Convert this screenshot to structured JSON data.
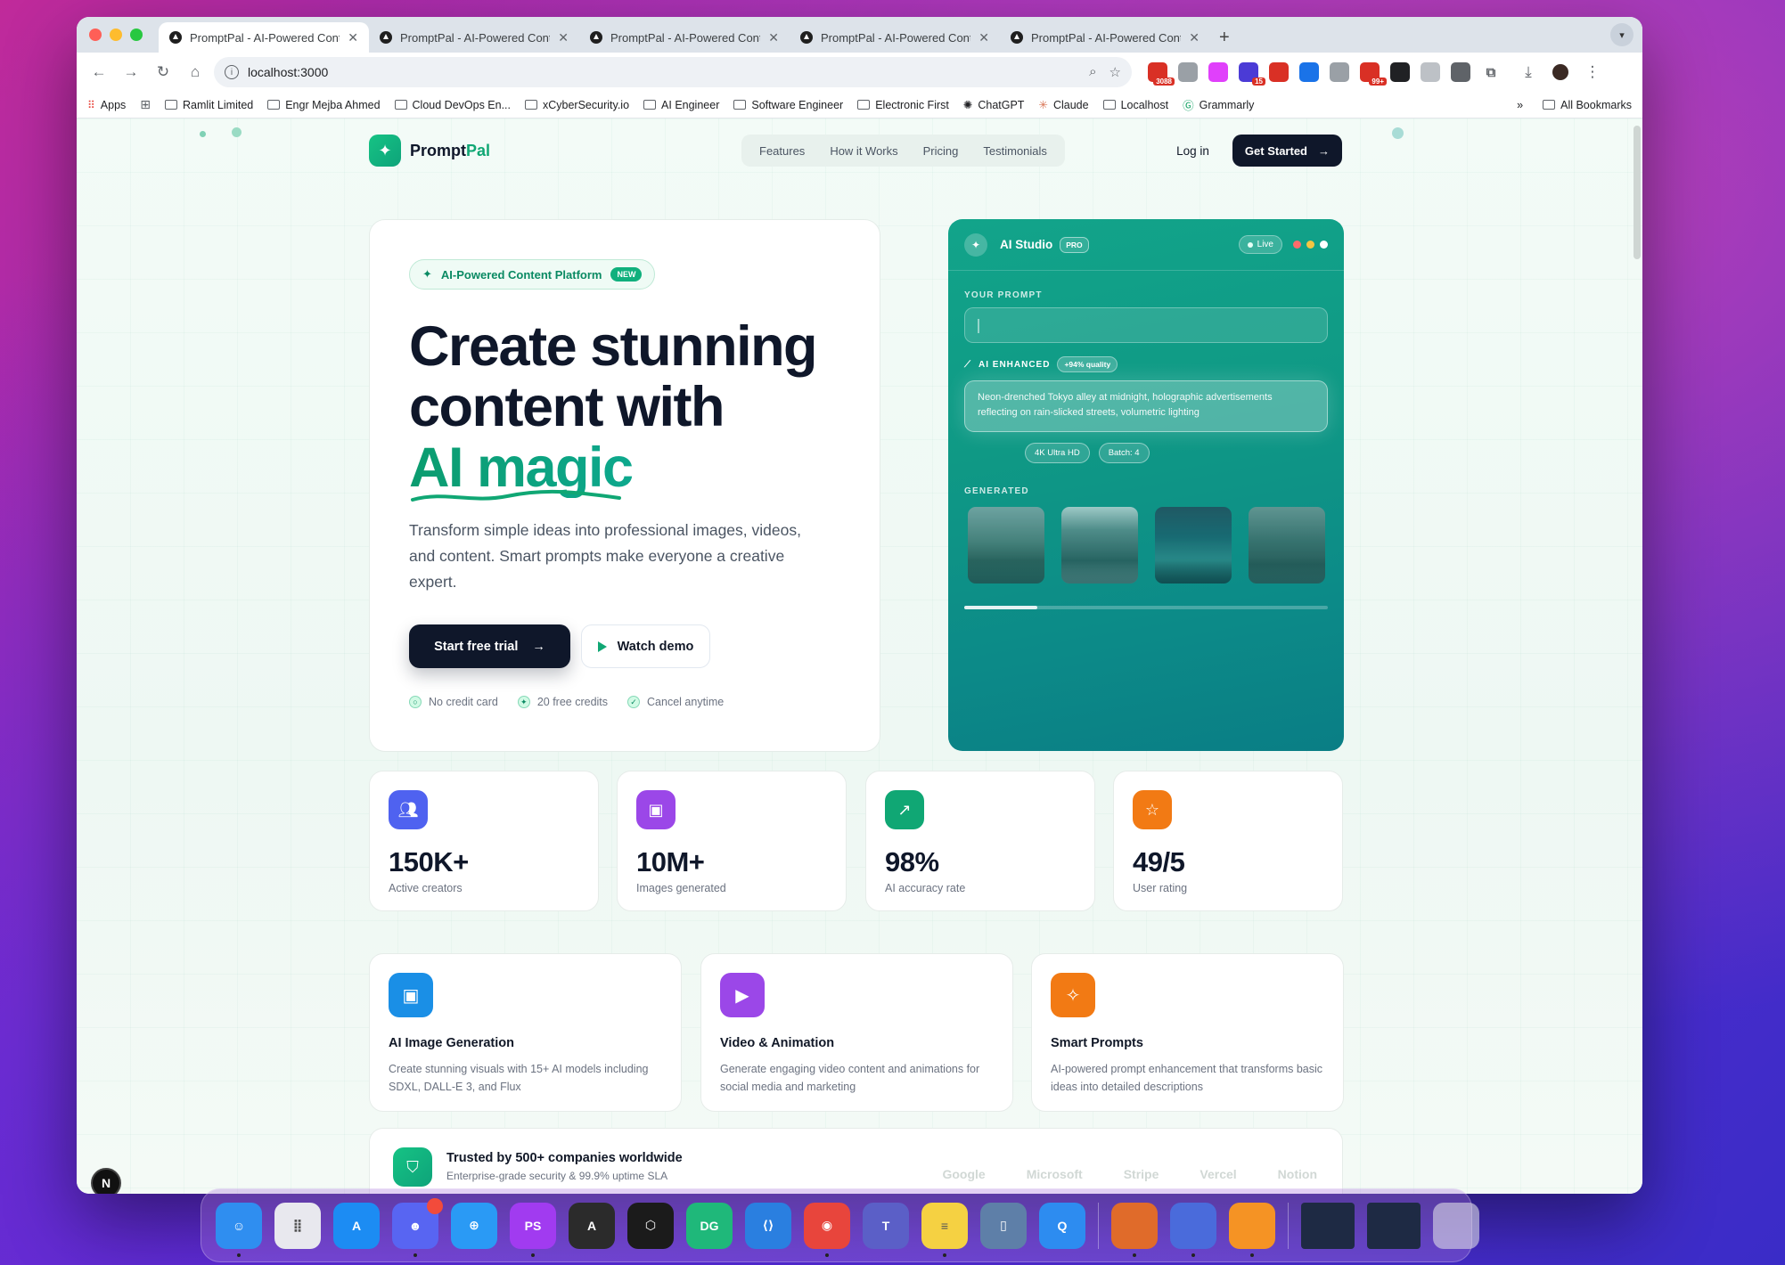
{
  "browser": {
    "tabs": [
      {
        "title": "PromptPal - AI-Powered Cont",
        "active": true
      },
      {
        "title": "PromptPal - AI-Powered Cont",
        "active": false
      },
      {
        "title": "PromptPal - AI-Powered Cont",
        "active": false
      },
      {
        "title": "PromptPal - AI-Powered Cont",
        "active": false
      },
      {
        "title": "PromptPal - AI-Powered Cont",
        "active": false
      }
    ],
    "url": "localhost:3000",
    "extensions": [
      {
        "name": "gmail-ext",
        "badge": "3088",
        "color": "#d93025"
      },
      {
        "name": "camera-ext",
        "badge": "",
        "color": "#9aa0a6"
      },
      {
        "name": "arrow-ext",
        "badge": "",
        "color": "#e040fb"
      },
      {
        "name": "hat-ext",
        "badge": "15",
        "color": "#4b3bd6"
      },
      {
        "name": "opera-ext",
        "badge": "",
        "color": "#d93025"
      },
      {
        "name": "tag-ext",
        "badge": "",
        "color": "#1a73e8"
      },
      {
        "name": "code-ext",
        "badge": "",
        "color": "#9aa0a6"
      },
      {
        "name": "mail-ext",
        "badge": "99+",
        "color": "#d93025"
      },
      {
        "name": "grid-ext",
        "badge": "",
        "color": "#202124"
      },
      {
        "name": "link-ext",
        "badge": "",
        "color": "#bdc1c6"
      },
      {
        "name": "pen-ext",
        "badge": "",
        "color": "#5f6368"
      }
    ],
    "bookmarks": [
      "Apps",
      "Ramlit Limited",
      "Engr Mejba Ahmed",
      "Cloud DevOps En...",
      "xCyberSecurity.io",
      "AI Engineer",
      "Software Engineer",
      "Electronic First",
      "ChatGPT",
      "Claude",
      "Localhost",
      "Grammarly"
    ],
    "all_bookmarks": "All Bookmarks",
    "more": "»"
  },
  "nav": {
    "brand": "Prompt",
    "brand_accent": "Pal",
    "links": [
      "Features",
      "How it Works",
      "Pricing",
      "Testimonials"
    ],
    "login": "Log in",
    "cta": "Get Started"
  },
  "hero": {
    "badge": "AI-Powered Content Platform",
    "badge_new": "NEW",
    "title_line1": "Create stunning",
    "title_line2": "content with",
    "title_highlight": "AI magic",
    "subtitle": "Transform simple ideas into professional images, videos, and content. Smart prompts make everyone a creative expert.",
    "primary_cta": "Start free trial",
    "secondary_cta": "Watch demo",
    "trust": [
      "No credit card",
      "20 free credits",
      "Cancel anytime"
    ]
  },
  "studio": {
    "title": "AI Studio",
    "badge": "PRO",
    "status": "Live",
    "prompt_label": "YOUR PROMPT",
    "enhanced_label": "AI ENHANCED",
    "quality": "+94% quality",
    "enhanced_text": "Neon-drenched Tokyo alley at midnight, holographic advertisements reflecting on rain-slicked streets, volumetric lighting",
    "chips": [
      "4K Ultra HD",
      "Batch: 4"
    ],
    "generated_label": "GENERATED",
    "progress": 0.2
  },
  "stats": [
    {
      "value": "150K+",
      "label": "Active creators",
      "icon": "users-icon",
      "color": "#4f62f0"
    },
    {
      "value": "10M+",
      "label": "Images generated",
      "icon": "image-icon",
      "color": "#9b47e8"
    },
    {
      "value": "98%",
      "label": "AI accuracy rate",
      "icon": "trending-up-icon",
      "color": "#10a774"
    },
    {
      "value": "49/5",
      "label": "User rating",
      "icon": "star-icon",
      "color": "#f27a14"
    }
  ],
  "features": [
    {
      "title": "AI Image Generation",
      "desc": "Create stunning visuals with 15+ AI models including SDXL, DALL-E 3, and Flux",
      "icon": "image-icon",
      "color": "#1a8fe6"
    },
    {
      "title": "Video & Animation",
      "desc": "Generate engaging video content and animations for social media and marketing",
      "icon": "video-icon",
      "color": "#9b47e8"
    },
    {
      "title": "Smart Prompts",
      "desc": "AI-powered prompt enhancement that transforms basic ideas into detailed descriptions",
      "icon": "magic-wand-icon",
      "color": "#f27a14"
    }
  ],
  "trusted": {
    "title": "Trusted by 500+ companies worldwide",
    "subtitle": "Enterprise-grade security & 99.9% uptime SLA",
    "brands": [
      "Google",
      "Microsoft",
      "Stripe",
      "Vercel",
      "Notion"
    ]
  },
  "dev_badge": "N",
  "dock": {
    "apps": [
      {
        "name": "finder",
        "label": "",
        "color": "#2f8ef0"
      },
      {
        "name": "launchpad",
        "label": "",
        "color": "#e8e8ee"
      },
      {
        "name": "app-store",
        "label": "A",
        "color": "#1c8cf3"
      },
      {
        "name": "discord",
        "label": "",
        "color": "#5865f2"
      },
      {
        "name": "safari",
        "label": "",
        "color": "#2a9af5"
      },
      {
        "name": "phpstorm",
        "label": "PS",
        "color": "#a13bf0"
      },
      {
        "name": "aurora",
        "label": "A",
        "color": "#2b2b2b"
      },
      {
        "name": "cursor",
        "label": "",
        "color": "#1b1b1b"
      },
      {
        "name": "datagrip",
        "label": "DG",
        "color": "#1fb87a"
      },
      {
        "name": "vscode",
        "label": "",
        "color": "#2a7fe0"
      },
      {
        "name": "chrome",
        "label": "",
        "color": "#e8453c"
      },
      {
        "name": "teams",
        "label": "T",
        "color": "#5b5fc7"
      },
      {
        "name": "notes",
        "label": "",
        "color": "#f5d142"
      },
      {
        "name": "simulator",
        "label": "",
        "color": "#5e7fa8"
      },
      {
        "name": "quicktime",
        "label": "Q",
        "color": "#2d8cf0"
      }
    ],
    "apps2": [
      {
        "name": "password-app",
        "color": "#e06b2a"
      },
      {
        "name": "bot-app",
        "color": "#4a6bdb"
      },
      {
        "name": "pages-app",
        "color": "#f59324"
      }
    ]
  }
}
